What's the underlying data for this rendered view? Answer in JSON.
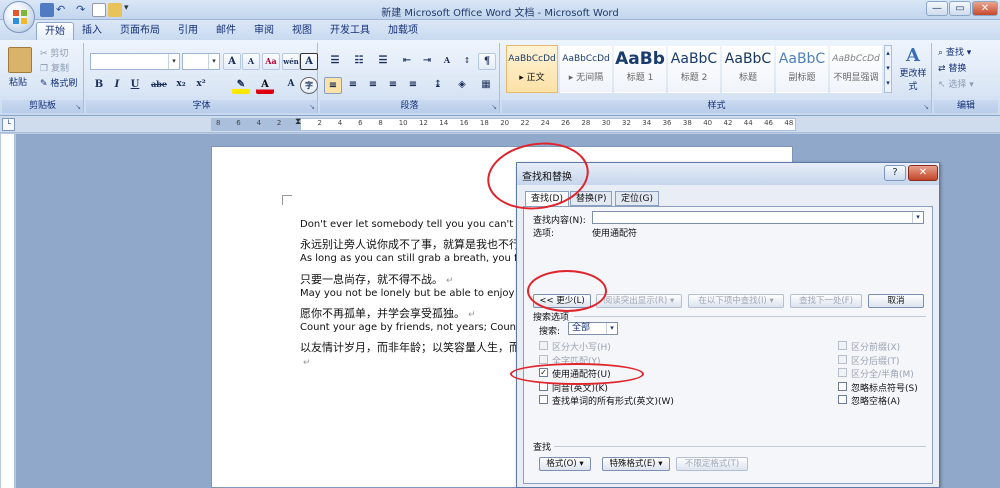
{
  "window": {
    "title": "新建 Microsoft Office Word 文档 - Microsoft Word",
    "min": "—",
    "restore": "▭",
    "close": "✕"
  },
  "tabs": [
    "开始",
    "插入",
    "页面布局",
    "引用",
    "邮件",
    "审阅",
    "视图",
    "开发工具",
    "加载项"
  ],
  "ribbon": {
    "clipboard": {
      "label": "剪贴板",
      "paste": "粘贴",
      "cut": "剪切",
      "copy": "复制",
      "format_painter": "格式刷"
    },
    "font": {
      "label": "字体",
      "bold": "B",
      "italic": "I",
      "underline": "U",
      "strike": "abe",
      "subscript": "x₂",
      "superscript": "x²",
      "clear": "Aa",
      "grow": "A",
      "shrink": "A",
      "phonetic": "wén",
      "border_char": "A"
    },
    "paragraph": {
      "label": "段落"
    },
    "styles": {
      "label": "样式",
      "items": [
        {
          "preview": "AaBbCcDd",
          "name": "▸ 正文"
        },
        {
          "preview": "AaBbCcDd",
          "name": "▸ 无间隔"
        },
        {
          "preview": "AaBb",
          "name": "标题 1"
        },
        {
          "preview": "AaBbC",
          "name": "标题 2"
        },
        {
          "preview": "AaBbC",
          "name": "标题"
        },
        {
          "preview": "AaBbC",
          "name": "副标题"
        },
        {
          "preview": "AaBbCcDd",
          "name": "不明显强调"
        }
      ],
      "change": "更改样式"
    },
    "editing": {
      "label": "编辑",
      "find": "查找 ▾",
      "replace": "替换",
      "select": "选择 ▾"
    }
  },
  "ruler": {
    "numbers": [
      "8",
      "6",
      "4",
      "2",
      "",
      "2",
      "4",
      "6",
      "8",
      "10",
      "12",
      "14",
      "16",
      "18",
      "20",
      "22",
      "24",
      "26",
      "28",
      "30",
      "32",
      "34",
      "36",
      "38",
      "40",
      "42",
      "44",
      "46",
      "48"
    ]
  },
  "document": {
    "lines": [
      {
        "text": "Don't ever let somebody tell you you can't do something",
        "cn": false
      },
      {
        "text": "永远别让旁人说你成不了事，就算是我也不行。",
        "cn": true
      },
      {
        "text": "As long as you can still grab a breath, you fight.",
        "cn": false
      },
      {
        "text": "只要一息尚存，就不得不战。",
        "cn": true
      },
      {
        "text": "May you not be lonely but be able to enjoy being alone",
        "cn": false
      },
      {
        "text": "愿你不再孤单，并学会享受孤独。",
        "cn": true
      },
      {
        "text": "Count your age by friends, not years; Count your life by smiles",
        "cn": false
      },
      {
        "text": "以友情计岁月，而非年龄；以笑容量人生，而非泪水",
        "cn": true
      },
      {
        "text": "",
        "cn": false
      }
    ],
    "para_mark": "↵"
  },
  "dialog": {
    "title": "查找和替换",
    "help": "?",
    "close": "✕",
    "tabs": [
      "查找(D)",
      "替换(P)",
      "定位(G)"
    ],
    "find_label": "查找内容(N):",
    "options_label": "选项:",
    "options_value": "使用通配符",
    "less_btn": "<< 更少(L)",
    "reading_highlight": "阅读突出显示(R) ▾",
    "find_in": "在以下项中查找(I) ▾",
    "find_next": "查找下一处(F)",
    "cancel": "取消",
    "search_options_title": "搜索选项",
    "search_label": "搜索:",
    "search_value": "全部",
    "left_opts": [
      {
        "label": "区分大小写(H)",
        "checked": false,
        "disabled": true
      },
      {
        "label": "全字匹配(Y)",
        "checked": false,
        "disabled": true
      },
      {
        "label": "使用通配符(U)",
        "checked": true,
        "disabled": false
      },
      {
        "label": "同音(英文)(K)",
        "checked": false,
        "disabled": false
      },
      {
        "label": "查找单词的所有形式(英文)(W)",
        "checked": false,
        "disabled": false
      }
    ],
    "right_opts": [
      {
        "label": "区分前缀(X)",
        "checked": false,
        "disabled": true
      },
      {
        "label": "区分后缀(T)",
        "checked": false,
        "disabled": true
      },
      {
        "label": "区分全/半角(M)",
        "checked": false,
        "disabled": true
      },
      {
        "label": "忽略标点符号(S)",
        "checked": false,
        "disabled": false
      },
      {
        "label": "忽略空格(A)",
        "checked": false,
        "disabled": false
      }
    ],
    "find_section": "查找",
    "format_btn": "格式(O) ▾",
    "special_btn": "特殊格式(E) ▾",
    "no_format_btn": "不限定格式(T)"
  },
  "colors": {
    "accent": "#15317a",
    "annotation": "#e0242c"
  }
}
